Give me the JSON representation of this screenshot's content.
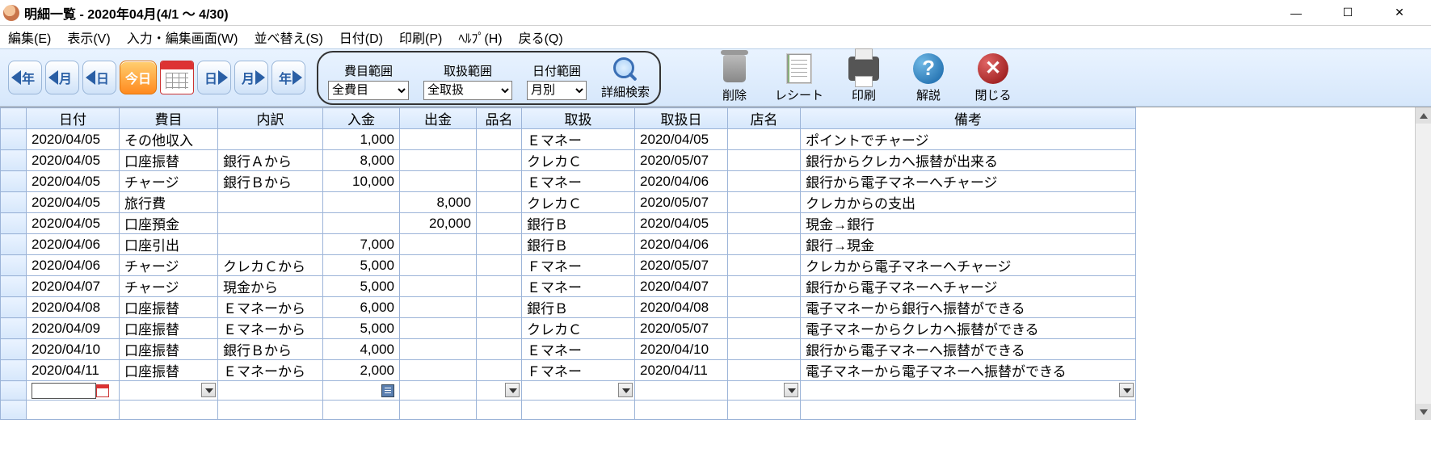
{
  "window": {
    "title": "明細一覧 - 2020年04月(4/1 ～ 4/30)"
  },
  "menu": [
    "編集(E)",
    "表示(V)",
    "入力・編集画面(W)",
    "並べ替え(S)",
    "日付(D)",
    "印刷(P)",
    "ﾍﾙﾌﾟ(H)",
    "戻る(Q)"
  ],
  "nav": {
    "prev_year": "年",
    "prev_month": "月",
    "prev_day": "日",
    "today": "今日",
    "next_day": "日",
    "next_month": "月",
    "next_year": "年"
  },
  "ranges": {
    "cat_label": "費目範囲",
    "cat_value": "全費目",
    "hand_label": "取扱範囲",
    "hand_value": "全取扱",
    "date_label": "日付範囲",
    "date_value": "月別",
    "search": "詳細検索"
  },
  "toolbtns": {
    "delete": "削除",
    "receipt": "レシート",
    "print": "印刷",
    "help": "解説",
    "close": "閉じる"
  },
  "columns": [
    "日付",
    "費目",
    "内訳",
    "入金",
    "出金",
    "品名",
    "取扱",
    "取扱日",
    "店名",
    "備考"
  ],
  "rows": [
    {
      "date": "2020/04/05",
      "cat": "その他収入",
      "sub": "",
      "in": "1,000",
      "out": "",
      "item": "",
      "hand": "Ｅマネー",
      "hdate": "2020/04/05",
      "shop": "",
      "note": "ポイントでチャージ"
    },
    {
      "date": "2020/04/05",
      "cat": "口座振替",
      "sub": "銀行Ａから",
      "in": "8,000",
      "out": "",
      "item": "",
      "hand": "クレカＣ",
      "hdate": "2020/05/07",
      "shop": "",
      "note": "銀行からクレカへ振替が出来る"
    },
    {
      "date": "2020/04/05",
      "cat": "チャージ",
      "sub": "銀行Ｂから",
      "in": "10,000",
      "out": "",
      "item": "",
      "hand": "Ｅマネー",
      "hdate": "2020/04/06",
      "shop": "",
      "note": "銀行から電子マネーへチャージ"
    },
    {
      "date": "2020/04/05",
      "cat": "旅行費",
      "sub": "",
      "in": "",
      "out": "8,000",
      "item": "",
      "hand": "クレカＣ",
      "hdate": "2020/05/07",
      "shop": "",
      "note": "クレカからの支出"
    },
    {
      "date": "2020/04/05",
      "cat": "口座預金",
      "sub": "",
      "in": "",
      "out": "20,000",
      "item": "",
      "hand": "銀行Ｂ",
      "hdate": "2020/04/05",
      "shop": "",
      "note": "現金→銀行"
    },
    {
      "date": "2020/04/06",
      "cat": "口座引出",
      "sub": "",
      "in": "7,000",
      "out": "",
      "item": "",
      "hand": "銀行Ｂ",
      "hdate": "2020/04/06",
      "shop": "",
      "note": "銀行→現金"
    },
    {
      "date": "2020/04/06",
      "cat": "チャージ",
      "sub": "クレカＣから",
      "in": "5,000",
      "out": "",
      "item": "",
      "hand": "Ｆマネー",
      "hdate": "2020/05/07",
      "shop": "",
      "note": "クレカから電子マネーへチャージ"
    },
    {
      "date": "2020/04/07",
      "cat": "チャージ",
      "sub": "現金から",
      "in": "5,000",
      "out": "",
      "item": "",
      "hand": "Ｅマネー",
      "hdate": "2020/04/07",
      "shop": "",
      "note": "銀行から電子マネーへチャージ"
    },
    {
      "date": "2020/04/08",
      "cat": "口座振替",
      "sub": "Ｅマネーから",
      "in": "6,000",
      "out": "",
      "item": "",
      "hand": "銀行Ｂ",
      "hdate": "2020/04/08",
      "shop": "",
      "note": "電子マネーから銀行へ振替ができる"
    },
    {
      "date": "2020/04/09",
      "cat": "口座振替",
      "sub": "Ｅマネーから",
      "in": "5,000",
      "out": "",
      "item": "",
      "hand": "クレカＣ",
      "hdate": "2020/05/07",
      "shop": "",
      "note": "電子マネーからクレカへ振替ができる"
    },
    {
      "date": "2020/04/10",
      "cat": "口座振替",
      "sub": "銀行Ｂから",
      "in": "4,000",
      "out": "",
      "item": "",
      "hand": "Ｅマネー",
      "hdate": "2020/04/10",
      "shop": "",
      "note": "銀行から電子マネーへ振替ができる"
    },
    {
      "date": "2020/04/11",
      "cat": "口座振替",
      "sub": "Ｅマネーから",
      "in": "2,000",
      "out": "",
      "item": "",
      "hand": "Ｆマネー",
      "hdate": "2020/04/11",
      "shop": "",
      "note": "電子マネーから電子マネーへ振替ができる"
    }
  ]
}
